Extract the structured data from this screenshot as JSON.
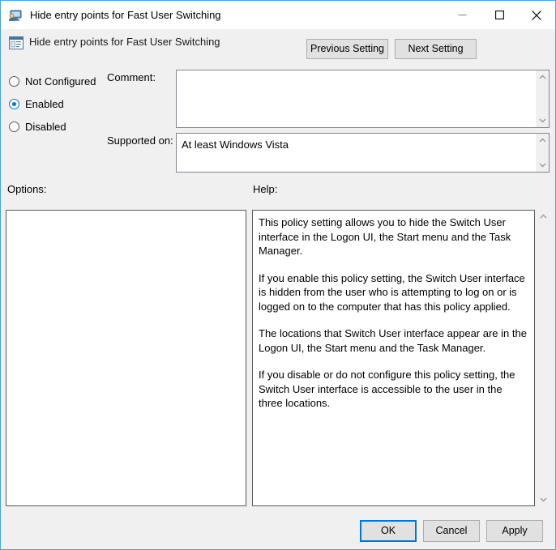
{
  "window": {
    "title": "Hide entry points for Fast User Switching",
    "title_icon": "policy-computer-icon",
    "controls": {
      "minimize": "minimize-icon",
      "maximize": "maximize-icon",
      "close": "close-icon"
    }
  },
  "header": {
    "icon": "policy-setting-icon",
    "title": "Hide entry points for Fast User Switching",
    "previous_setting_label": "Previous Setting",
    "next_setting_label": "Next Setting"
  },
  "state_options": [
    {
      "label": "Not Configured",
      "selected": false
    },
    {
      "label": "Enabled",
      "selected": true
    },
    {
      "label": "Disabled",
      "selected": false
    }
  ],
  "comment": {
    "label": "Comment:",
    "value": "",
    "scroll_up_icon": "chevron-up-icon",
    "scroll_down_icon": "chevron-down-icon"
  },
  "supported_on": {
    "label": "Supported on:",
    "value": "At least Windows Vista",
    "scroll_up_icon": "chevron-up-icon",
    "scroll_down_icon": "chevron-down-icon"
  },
  "options": {
    "label": "Options:",
    "content": ""
  },
  "help": {
    "label": "Help:",
    "paragraphs": [
      "This policy setting allows you to hide the Switch User interface in the Logon UI, the Start menu and the Task Manager.",
      "If you enable this policy setting, the Switch User interface is hidden from the user who is attempting to log on or is logged on to the computer that has this policy applied.",
      "The locations that Switch User interface appear are in the Logon UI, the Start menu and the Task Manager.",
      "If you disable or do not configure this policy setting, the Switch User interface is accessible to the user in the three locations."
    ],
    "scroll_up_icon": "chevron-up-icon",
    "scroll_down_icon": "chevron-down-icon"
  },
  "footer": {
    "ok_label": "OK",
    "cancel_label": "Cancel",
    "apply_label": "Apply"
  },
  "colors": {
    "accent": "#0078d7",
    "window_border": "#4aa3df",
    "dialog_background": "#f0f0f0",
    "button_face": "#e1e1e1",
    "button_border": "#adadad",
    "field_border": "#828790"
  }
}
